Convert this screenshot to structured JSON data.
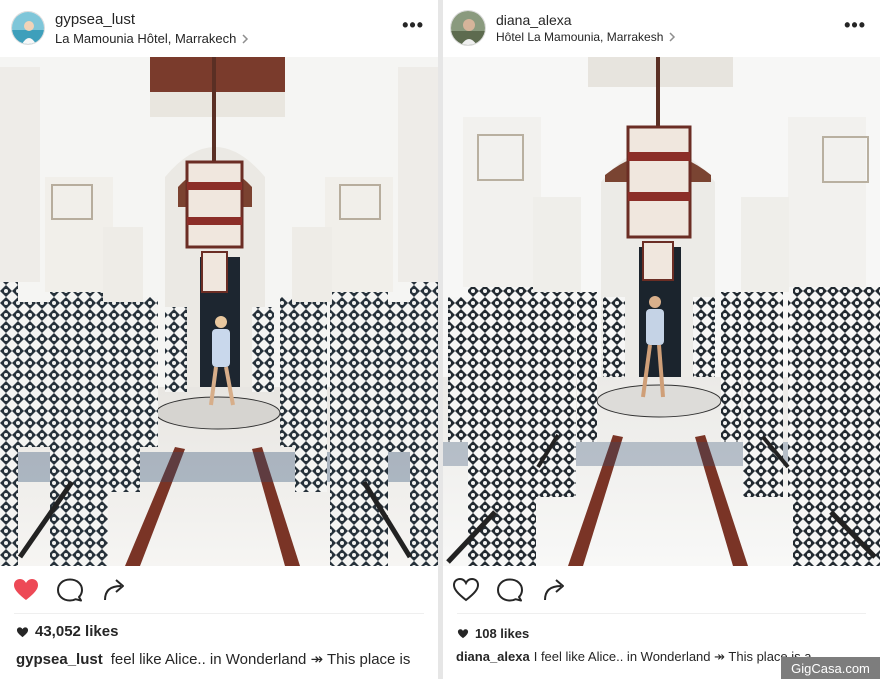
{
  "posts": [
    {
      "username": "gypsea_lust",
      "location": "La Mamounia Hôtel, Marrakech",
      "more_label": "•••",
      "liked": true,
      "likes_text": "43,052 likes",
      "caption_user": "gypsea_lust",
      "caption_text": "feel like Alice.. in Wonderland ↠ This place is"
    },
    {
      "username": "diana_alexa",
      "location": "Hôtel La Mamounia, Marrakesh",
      "more_label": "•••",
      "liked": false,
      "likes_text": "108 likes",
      "caption_user": "diana_alexa",
      "caption_text": "I feel like Alice.. in Wonderland ↠ This place is a"
    }
  ],
  "watermark": "GigCasa.com",
  "icons": {
    "heart": "heart-icon",
    "comment": "comment-icon",
    "share": "share-icon",
    "chevron": "chevron-right-icon",
    "more": "more-options-icon"
  },
  "colors": {
    "liked_heart": "#ed4956",
    "text": "#262626",
    "tile_dark": "#1f2a33",
    "tile_blue": "#3b6fa0"
  }
}
